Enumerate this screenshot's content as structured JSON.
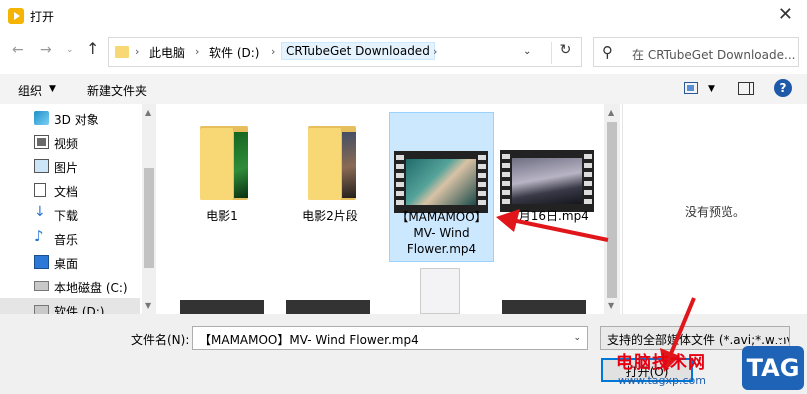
{
  "window": {
    "title": "打开",
    "close_glyph": "✕"
  },
  "nav": {
    "back": "←",
    "forward": "→",
    "recent": "⌄",
    "up": "↑"
  },
  "address": {
    "segments": [
      "此电脑",
      "软件 (D:)",
      "CRTubeGet Downloaded"
    ],
    "separator": "›",
    "dropdown_glyph": "⌄",
    "refresh_glyph": "↻"
  },
  "search": {
    "placeholder": "在 CRTubeGet Downloade...",
    "icon_glyph": "⚲"
  },
  "toolbar": {
    "organize": "组织",
    "organize_caret": "▼",
    "new_folder": "新建文件夹",
    "view_caret": "▼",
    "help": "?"
  },
  "sidebar": {
    "items": [
      {
        "label": "3D 对象"
      },
      {
        "label": "视频"
      },
      {
        "label": "图片"
      },
      {
        "label": "文档"
      },
      {
        "label": "下载",
        "icon": "↓"
      },
      {
        "label": "音乐",
        "icon": "♪"
      },
      {
        "label": "桌面"
      },
      {
        "label": "本地磁盘 (C:)"
      },
      {
        "label": "软件 (D:)"
      }
    ],
    "scroll_up": "▲",
    "scroll_down": "▼"
  },
  "files": [
    {
      "name": "电影1",
      "type": "folder"
    },
    {
      "name": "电影2片段",
      "type": "folder"
    },
    {
      "name": "【MAMAMOO】MV- Wind Flower.mp4",
      "type": "video",
      "selected": true
    },
    {
      "name": "2月16日.mp4",
      "type": "video"
    }
  ],
  "content_scroll": {
    "up": "▲",
    "down": "▼"
  },
  "preview": {
    "empty_text": "没有预览。"
  },
  "bottom": {
    "filename_label": "文件名(N):",
    "filename_value": "【MAMAMOO】MV- Wind Flower.mp4",
    "filename_caret": "⌄",
    "filetype_value": "支持的全部媒体文件 (*.avi;*.wmv;*.",
    "filetype_caret": "⌄",
    "open_label": "打开(O)"
  },
  "watermark": {
    "title": "电脑技术网",
    "url": "www.tagxp.com",
    "tag": "TAG"
  },
  "colors": {
    "selection": "#cce8ff",
    "accent": "#0078d7",
    "arrow": "#e0161a"
  }
}
